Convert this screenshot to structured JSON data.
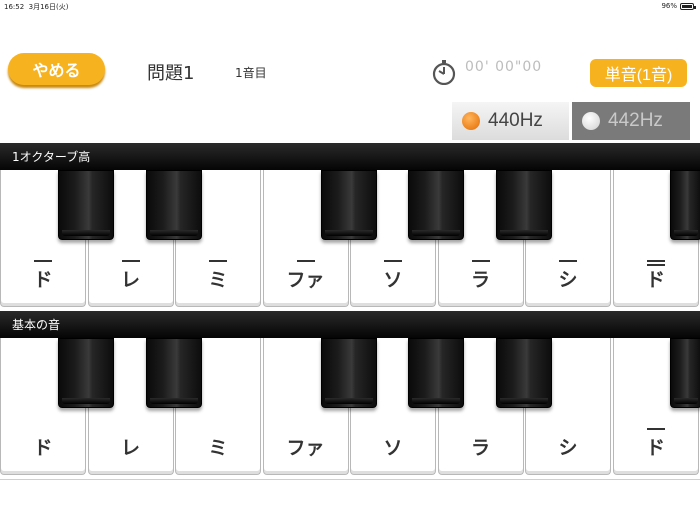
{
  "status_bar": {
    "time": "16:52",
    "date": "3月16日(火)",
    "battery": "96%"
  },
  "header": {
    "quit_label": "やめる",
    "question_title": "問題1",
    "note_index": "1音目",
    "timer": "00' 00\"00",
    "mode_label": "単音(1音)"
  },
  "tuning": {
    "options": [
      {
        "label": "440Hz",
        "selected": true
      },
      {
        "label": "442Hz",
        "selected": false
      }
    ],
    "selected_color": "#f08a12"
  },
  "sections": [
    {
      "title": "1オクターブ高",
      "keys": [
        {
          "label": "ド",
          "marks": 1
        },
        {
          "label": "レ",
          "marks": 1
        },
        {
          "label": "ミ",
          "marks": 1
        },
        {
          "label": "ファ",
          "marks": 1
        },
        {
          "label": "ソ",
          "marks": 1
        },
        {
          "label": "ラ",
          "marks": 1
        },
        {
          "label": "シ",
          "marks": 1
        },
        {
          "label": "ド",
          "marks": 2
        }
      ]
    },
    {
      "title": "基本の音",
      "keys": [
        {
          "label": "ド",
          "marks": 0
        },
        {
          "label": "レ",
          "marks": 0
        },
        {
          "label": "ミ",
          "marks": 0
        },
        {
          "label": "ファ",
          "marks": 0
        },
        {
          "label": "ソ",
          "marks": 0
        },
        {
          "label": "ラ",
          "marks": 0
        },
        {
          "label": "シ",
          "marks": 0
        },
        {
          "label": "ド",
          "marks": 1
        }
      ]
    }
  ],
  "colors": {
    "accent": "#f7b21f",
    "header_bar": "#111111"
  }
}
